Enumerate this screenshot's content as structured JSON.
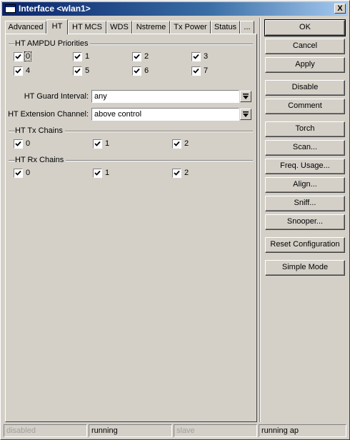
{
  "window": {
    "title": "Interface <wlan1>",
    "close_glyph": "X",
    "icon": "window-icon"
  },
  "tabs": [
    {
      "label": "Advanced",
      "active": false
    },
    {
      "label": "HT",
      "active": true
    },
    {
      "label": "HT MCS",
      "active": false
    },
    {
      "label": "WDS",
      "active": false
    },
    {
      "label": "Nstreme",
      "active": false
    },
    {
      "label": "Tx Power",
      "active": false
    },
    {
      "label": "Status",
      "active": false
    },
    {
      "label": "...",
      "active": false
    }
  ],
  "ampdu": {
    "title": "HT AMPDU Priorities",
    "items": [
      {
        "label": "0",
        "checked": true
      },
      {
        "label": "1",
        "checked": true
      },
      {
        "label": "2",
        "checked": true
      },
      {
        "label": "3",
        "checked": true
      },
      {
        "label": "4",
        "checked": true
      },
      {
        "label": "5",
        "checked": true
      },
      {
        "label": "6",
        "checked": true
      },
      {
        "label": "7",
        "checked": true
      }
    ]
  },
  "guard_interval": {
    "label": "HT Guard Interval:",
    "value": "any"
  },
  "extension_channel": {
    "label": "HT Extension Channel:",
    "value": "above control"
  },
  "tx_chains": {
    "title": "HT Tx Chains",
    "items": [
      {
        "label": "0",
        "checked": true
      },
      {
        "label": "1",
        "checked": true
      },
      {
        "label": "2",
        "checked": true
      }
    ]
  },
  "rx_chains": {
    "title": "HT Rx Chains",
    "items": [
      {
        "label": "0",
        "checked": true
      },
      {
        "label": "1",
        "checked": true
      },
      {
        "label": "2",
        "checked": true
      }
    ]
  },
  "buttons": {
    "ok": "OK",
    "cancel": "Cancel",
    "apply": "Apply",
    "disable": "Disable",
    "comment": "Comment",
    "torch": "Torch",
    "scan": "Scan...",
    "freq_usage": "Freq. Usage...",
    "align": "Align...",
    "sniff": "Sniff...",
    "snooper": "Snooper...",
    "reset_configuration": "Reset Configuration",
    "simple_mode": "Simple Mode"
  },
  "status": {
    "enabled": "disabled",
    "running": "running",
    "slave": "slave",
    "state": "running ap"
  },
  "colors": {
    "titlebar_start": "#0a246a",
    "titlebar_end": "#a6caf0",
    "face": "#d4d0c8"
  }
}
